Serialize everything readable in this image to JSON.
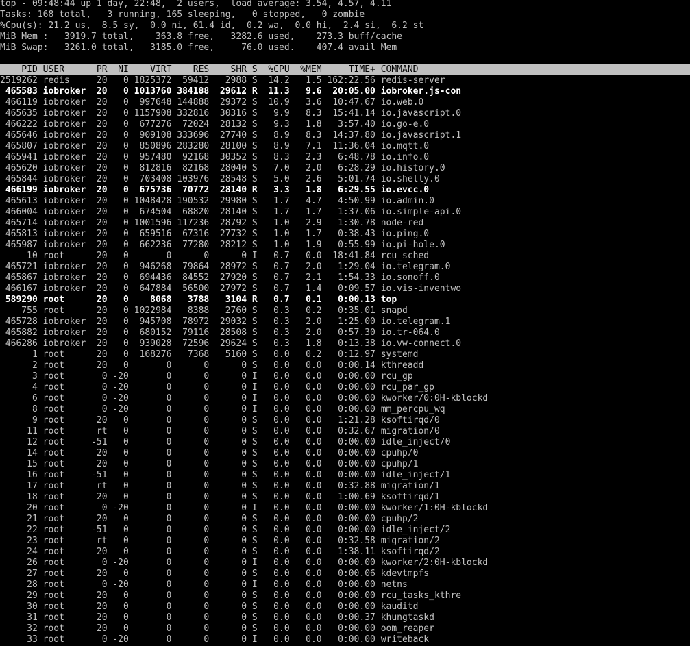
{
  "window": {
    "title": "top"
  },
  "colors": {
    "background": "#000000",
    "text": "#c0c0c0",
    "bold_text": "#ffffff",
    "header_bg": "#c0c0c0",
    "header_text": "#000000"
  },
  "summary": {
    "uptime_line": "top - 09:48:44 up 1 day, 22:48,  2 users,  load average: 3.54, 4.57, 4.11",
    "tasks_line": "Tasks: 168 total,   3 running, 165 sleeping,   0 stopped,   0 zombie",
    "cpu_line": "%Cpu(s): 21.2 us,  8.5 sy,  0.0 ni, 61.4 id,  0.2 wa,  0.0 hi,  2.4 si,  6.2 st",
    "mem_line": "MiB Mem :   3919.7 total,    363.8 free,   3282.6 used,    273.3 buff/cache",
    "swap_line": "MiB Swap:   3261.0 total,   3185.0 free,     76.0 used.    407.4 avail Mem"
  },
  "table": {
    "header": "    PID USER      PR  NI    VIRT    RES    SHR S  %CPU  %MEM     TIME+ COMMAND",
    "rows": [
      {
        "text": "2519262 redis     20   0 1825372  59412   2988 S  14.2   1.5 162:22.56 redis-server",
        "bold": false
      },
      {
        "text": " 465583 iobroker  20   0 1013760 384188  29612 R  11.3   9.6  20:05.00 iobroker.js-con",
        "bold": true
      },
      {
        "text": " 466119 iobroker  20   0  997648 144888  29372 S  10.9   3.6  10:47.67 io.web.0",
        "bold": false
      },
      {
        "text": " 465635 iobroker  20   0 1157908 332816  30316 S   9.9   8.3  15:41.14 io.javascript.0",
        "bold": false
      },
      {
        "text": " 466222 iobroker  20   0  677276  72024  28132 S   9.3   1.8   3:57.40 io.go-e.0",
        "bold": false
      },
      {
        "text": " 465646 iobroker  20   0  909108 333696  27740 S   8.9   8.3  14:37.80 io.javascript.1",
        "bold": false
      },
      {
        "text": " 465807 iobroker  20   0  850896 283280  28100 S   8.9   7.1  11:36.04 io.mqtt.0",
        "bold": false
      },
      {
        "text": " 465941 iobroker  20   0  957480  92168  30352 S   8.3   2.3   6:48.78 io.info.0",
        "bold": false
      },
      {
        "text": " 465620 iobroker  20   0  812816  82168  28040 S   7.0   2.0   6:28.29 io.history.0",
        "bold": false
      },
      {
        "text": " 465844 iobroker  20   0  703408 103976  28548 S   5.0   2.6   5:01.74 io.shelly.0",
        "bold": false
      },
      {
        "text": " 466199 iobroker  20   0  675736  70772  28140 R   3.3   1.8   6:29.55 io.evcc.0",
        "bold": true
      },
      {
        "text": " 465613 iobroker  20   0 1048428 190532  29980 S   1.7   4.7   4:50.99 io.admin.0",
        "bold": false
      },
      {
        "text": " 466004 iobroker  20   0  674504  68820  28140 S   1.7   1.7   1:37.06 io.simple-api.0",
        "bold": false
      },
      {
        "text": " 465714 iobroker  20   0 1001596 117236  28792 S   1.0   2.9   1:30.78 node-red",
        "bold": false
      },
      {
        "text": " 465813 iobroker  20   0  659516  67316  27732 S   1.0   1.7   0:38.43 io.ping.0",
        "bold": false
      },
      {
        "text": " 465987 iobroker  20   0  662236  77280  28212 S   1.0   1.9   0:55.99 io.pi-hole.0",
        "bold": false
      },
      {
        "text": "     10 root      20   0       0      0      0 I   0.7   0.0  18:41.84 rcu_sched",
        "bold": false
      },
      {
        "text": " 465721 iobroker  20   0  946268  79864  28972 S   0.7   2.0   1:29.04 io.telegram.0",
        "bold": false
      },
      {
        "text": " 465867 iobroker  20   0  694436  84552  27920 S   0.7   2.1   1:54.33 io.sonoff.0",
        "bold": false
      },
      {
        "text": " 466167 iobroker  20   0  647884  56500  27972 S   0.7   1.4   0:09.57 io.vis-inventwo",
        "bold": false
      },
      {
        "text": " 589290 root      20   0    8068   3788   3104 R   0.7   0.1   0:00.13 top",
        "bold": true
      },
      {
        "text": "    755 root      20   0 1022984   8388   2760 S   0.3   0.2   0:35.01 snapd",
        "bold": false
      },
      {
        "text": " 465728 iobroker  20   0  945708  78972  29032 S   0.3   2.0   1:25.00 io.telegram.1",
        "bold": false
      },
      {
        "text": " 465882 iobroker  20   0  680152  79116  28508 S   0.3   2.0   0:57.30 io.tr-064.0",
        "bold": false
      },
      {
        "text": " 466286 iobroker  20   0  939028  72596  29624 S   0.3   1.8   0:13.38 io.vw-connect.0",
        "bold": false
      },
      {
        "text": "      1 root      20   0  168276   7368   5160 S   0.0   0.2   0:12.97 systemd",
        "bold": false
      },
      {
        "text": "      2 root      20   0       0      0      0 S   0.0   0.0   0:00.14 kthreadd",
        "bold": false
      },
      {
        "text": "      3 root       0 -20       0      0      0 I   0.0   0.0   0:00.00 rcu_gp",
        "bold": false
      },
      {
        "text": "      4 root       0 -20       0      0      0 I   0.0   0.0   0:00.00 rcu_par_gp",
        "bold": false
      },
      {
        "text": "      6 root       0 -20       0      0      0 I   0.0   0.0   0:00.00 kworker/0:0H-kblockd",
        "bold": false
      },
      {
        "text": "      8 root       0 -20       0      0      0 I   0.0   0.0   0:00.00 mm_percpu_wq",
        "bold": false
      },
      {
        "text": "      9 root      20   0       0      0      0 S   0.0   0.0   1:21.28 ksoftirqd/0",
        "bold": false
      },
      {
        "text": "     11 root      rt   0       0      0      0 S   0.0   0.0   0:32.67 migration/0",
        "bold": false
      },
      {
        "text": "     12 root     -51   0       0      0      0 S   0.0   0.0   0:00.00 idle_inject/0",
        "bold": false
      },
      {
        "text": "     14 root      20   0       0      0      0 S   0.0   0.0   0:00.00 cpuhp/0",
        "bold": false
      },
      {
        "text": "     15 root      20   0       0      0      0 S   0.0   0.0   0:00.00 cpuhp/1",
        "bold": false
      },
      {
        "text": "     16 root     -51   0       0      0      0 S   0.0   0.0   0:00.00 idle_inject/1",
        "bold": false
      },
      {
        "text": "     17 root      rt   0       0      0      0 S   0.0   0.0   0:32.88 migration/1",
        "bold": false
      },
      {
        "text": "     18 root      20   0       0      0      0 S   0.0   0.0   1:00.69 ksoftirqd/1",
        "bold": false
      },
      {
        "text": "     20 root       0 -20       0      0      0 I   0.0   0.0   0:00.00 kworker/1:0H-kblockd",
        "bold": false
      },
      {
        "text": "     21 root      20   0       0      0      0 S   0.0   0.0   0:00.00 cpuhp/2",
        "bold": false
      },
      {
        "text": "     22 root     -51   0       0      0      0 S   0.0   0.0   0:00.00 idle_inject/2",
        "bold": false
      },
      {
        "text": "     23 root      rt   0       0      0      0 S   0.0   0.0   0:32.58 migration/2",
        "bold": false
      },
      {
        "text": "     24 root      20   0       0      0      0 S   0.0   0.0   1:38.11 ksoftirqd/2",
        "bold": false
      },
      {
        "text": "     26 root       0 -20       0      0      0 I   0.0   0.0   0:00.00 kworker/2:0H-kblockd",
        "bold": false
      },
      {
        "text": "     27 root      20   0       0      0      0 S   0.0   0.0   0:00.06 kdevtmpfs",
        "bold": false
      },
      {
        "text": "     28 root       0 -20       0      0      0 I   0.0   0.0   0:00.00 netns",
        "bold": false
      },
      {
        "text": "     29 root      20   0       0      0      0 S   0.0   0.0   0:00.00 rcu_tasks_kthre",
        "bold": false
      },
      {
        "text": "     30 root      20   0       0      0      0 S   0.0   0.0   0:00.00 kauditd",
        "bold": false
      },
      {
        "text": "     31 root      20   0       0      0      0 S   0.0   0.0   0:00.37 khungtaskd",
        "bold": false
      },
      {
        "text": "     32 root      20   0       0      0      0 S   0.0   0.0   0:00.00 oom_reaper",
        "bold": false
      },
      {
        "text": "     33 root       0 -20       0      0      0 I   0.0   0.0   0:00.00 writeback",
        "bold": false
      }
    ]
  }
}
